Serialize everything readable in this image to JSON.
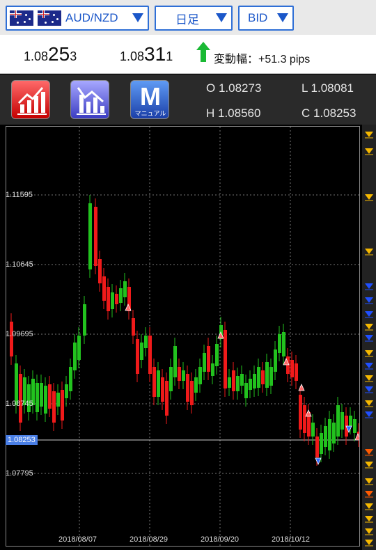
{
  "top_bar": {
    "pair": "AUD/NZD",
    "timeframe": "日足",
    "price_type": "BID"
  },
  "prices": {
    "bid_small": "1.08",
    "bid_big": "25",
    "bid_tail": "3",
    "ask_small": "1.08",
    "ask_big": "31",
    "ask_tail": "1",
    "change_label": "変動幅：+51.3 pips"
  },
  "tools": {
    "manual_letter": "M",
    "manual_sub": "マニュアル"
  },
  "ohlc": {
    "open": "O 1.08273",
    "low": "L 1.08081",
    "high": "H 1.08560",
    "close": "C 1.08253"
  },
  "chart_data": {
    "type": "candlestick",
    "y_ticks": [
      "1.11595",
      "1.10645",
      "1.09695",
      "1.08745",
      "1.07795"
    ],
    "current_price": "1.08253",
    "x_ticks": [
      "2018/08/07",
      "2018/08/29",
      "2018/09/20",
      "2018/10/12"
    ],
    "ylim": [
      1.0745,
      1.1255
    ],
    "colors": {
      "up": "#22c21e",
      "down": "#f01a1a",
      "grid": "#777777"
    }
  }
}
